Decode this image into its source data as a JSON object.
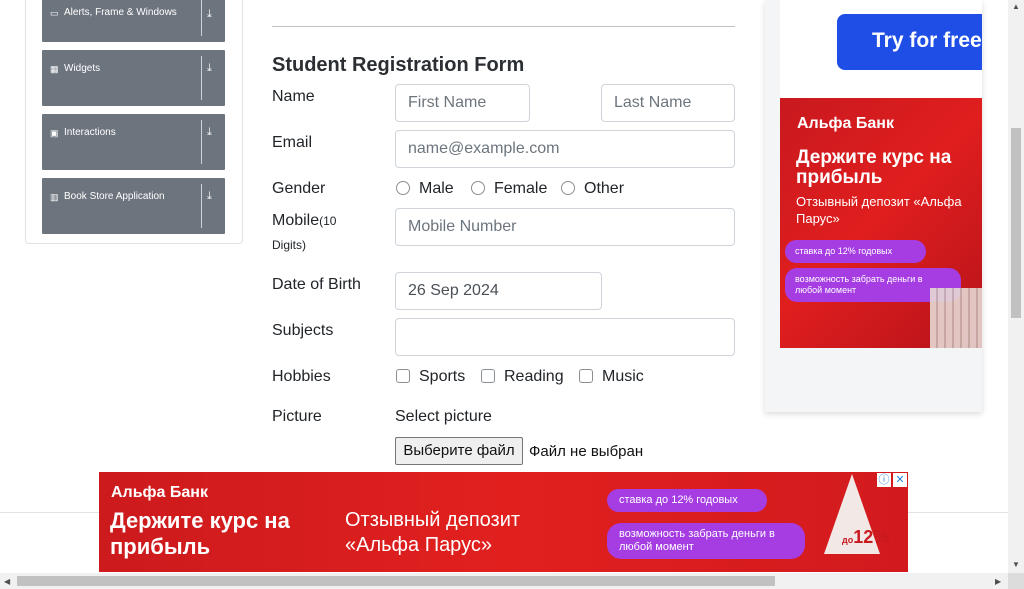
{
  "sidebar": {
    "items": [
      {
        "label": "Alerts, Frame & Windows",
        "icon": "window-icon"
      },
      {
        "label": "Widgets",
        "icon": "grid-icon"
      },
      {
        "label": "Interactions",
        "icon": "square-icon"
      },
      {
        "label": "Book Store Application",
        "icon": "books-icon"
      }
    ]
  },
  "form": {
    "title": "Student Registration Form",
    "name_label": "Name",
    "first_name_placeholder": "First Name",
    "last_name_placeholder": "Last Name",
    "email_label": "Email",
    "email_placeholder": "name@example.com",
    "gender_label": "Gender",
    "genders": [
      "Male",
      "Female",
      "Other"
    ],
    "mobile_label": "Mobile",
    "mobile_hint": "(10",
    "mobile_hint2": "Digits)",
    "mobile_placeholder": "Mobile Number",
    "dob_label": "Date of Birth",
    "dob_value": "26 Sep 2024",
    "subjects_label": "Subjects",
    "hobbies_label": "Hobbies",
    "hobbies": [
      "Sports",
      "Reading",
      "Music"
    ],
    "picture_label": "Picture",
    "select_picture": "Select picture",
    "file_button": "Выберите файл",
    "file_status": "Файл не выбран"
  },
  "ad_right": {
    "try_button": "Try for free →",
    "bank": "Альфа Банк",
    "headline": "Держите курс на прибыль",
    "sub": "Отзывный депозит «Альфа Парус»",
    "pill1": "ставка до 12% годовых",
    "pill2": "возможность забрать деньги в любой момент"
  },
  "ad_bottom": {
    "bank": "Альфа Банк",
    "headline": "Держите курс на прибыль",
    "sub": "Отзывный депозит «Альфа Парус»",
    "pill1": "ставка до 12% годовых",
    "pill2": "возможность забрать деньги в любой момент",
    "rate": "12%",
    "rate_prefix": "до"
  },
  "colors": {
    "sidebar_item": "#6c747d",
    "ad_red": "#e01e1e",
    "pill_purple": "#a53de3",
    "try_blue": "#1f4ee6"
  }
}
